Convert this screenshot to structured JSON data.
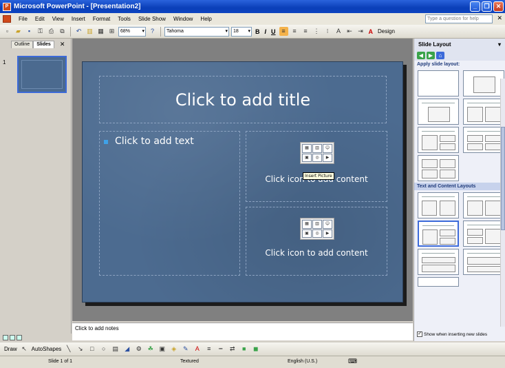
{
  "window": {
    "title": "Microsoft PowerPoint - [Presentation2]"
  },
  "menu": {
    "items": [
      "File",
      "Edit",
      "View",
      "Insert",
      "Format",
      "Tools",
      "Slide Show",
      "Window",
      "Help"
    ],
    "ask_placeholder": "Type a question for help"
  },
  "toolbar": {
    "zoom": "68%",
    "font": "Tahoma",
    "size": "18",
    "bold": "B",
    "italic": "I",
    "underline": "U",
    "font_color": "A",
    "design": "Design"
  },
  "left_pane": {
    "tabs": [
      "Outline",
      "Slides"
    ],
    "slide_number": "1"
  },
  "slide": {
    "title_placeholder": "Click to add title",
    "text_placeholder": "Click to add text",
    "content_placeholder_1": "Click icon to add content",
    "content_placeholder_2": "Click icon to add content",
    "tooltip": "Insert Picture"
  },
  "notes": {
    "placeholder": "Click to add notes"
  },
  "task_pane": {
    "title": "Slide Layout",
    "apply_label": "Apply slide layout:",
    "section_text_content": "Text and Content Layouts",
    "show_when_inserting": "Show when inserting new slides"
  },
  "draw_toolbar": {
    "draw": "Draw",
    "autoshapes": "AutoShapes"
  },
  "status": {
    "slide_of": "Slide 1 of 1",
    "design": "Textured",
    "language": "English (U.S.)"
  },
  "colors": {
    "title_bar": "#0a3fb8",
    "slide_background": "#4c6b90",
    "bullet": "#3fa2e8"
  }
}
